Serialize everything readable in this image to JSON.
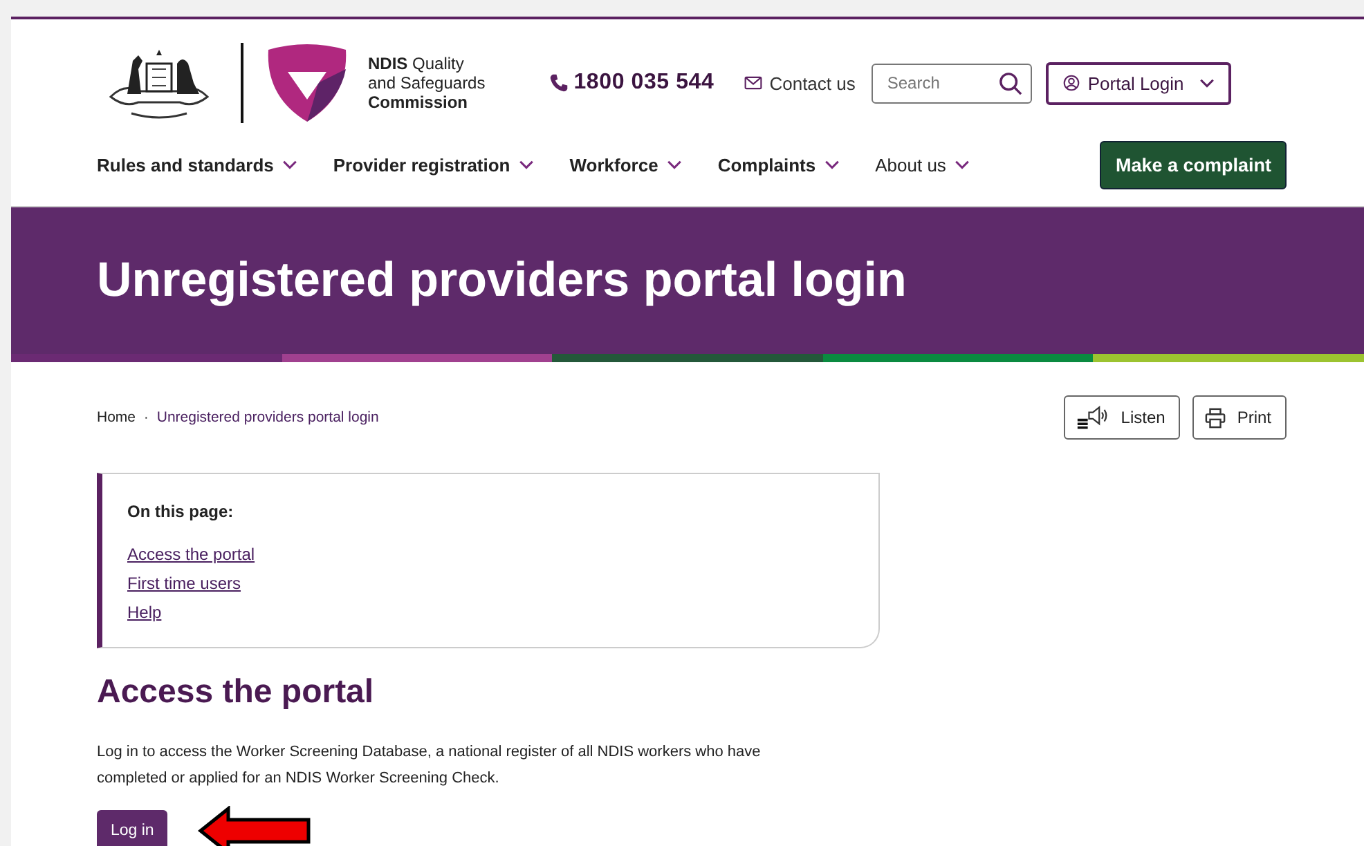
{
  "header": {
    "logo_lines": [
      "**NDIS** Quality",
      "and Safeguards",
      "Commission"
    ],
    "phone": "1800 035 544",
    "contact": "Contact us",
    "search": {
      "placeholder": "Search"
    },
    "portal_login": "Portal Login"
  },
  "nav": {
    "items": [
      {
        "label": "Rules and standards",
        "bold": true
      },
      {
        "label": "Provider registration",
        "bold": true
      },
      {
        "label": "Workforce",
        "bold": true
      },
      {
        "label": "Complaints",
        "bold": true
      },
      {
        "label": "About us",
        "bold": false
      }
    ],
    "cta": "Make a complaint"
  },
  "banner": {
    "title": "Unregistered providers portal login"
  },
  "breadcrumb": [
    "Home",
    "Unregistered providers portal login"
  ],
  "breadcrumb_separator": "·",
  "actions": [
    {
      "kind": "listen",
      "label": "Listen"
    },
    {
      "kind": "print",
      "label": "Print"
    }
  ],
  "on_this_page": {
    "title": "On this page:",
    "links": [
      "Access the portal",
      "First time users",
      "Help"
    ]
  },
  "section": {
    "heading": "Access the portal",
    "text": "Log in to access the Worker Screening Database, a national register of all NDIS workers who have completed or applied for an NDIS Worker Screening Check.",
    "button": "Log in"
  },
  "annotation": {
    "kind": "arrow"
  }
}
